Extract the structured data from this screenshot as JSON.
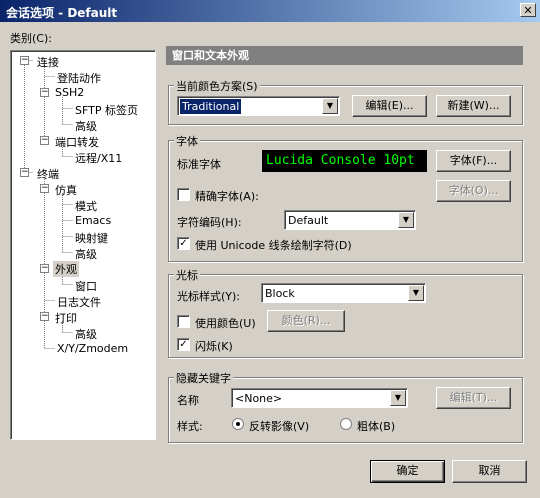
{
  "window": {
    "title": "会话选项 - Default",
    "close_glyph": "✕"
  },
  "tree": {
    "label": "类别(C):",
    "nodes": [
      {
        "label": "连接",
        "expanded": true
      },
      {
        "label": "登陆动作"
      },
      {
        "label": "SSH2",
        "expanded": true
      },
      {
        "label": "SFTP 标签页"
      },
      {
        "label": "高级"
      },
      {
        "label": "端口转发",
        "expanded": true
      },
      {
        "label": "远程/X11"
      },
      {
        "label": "终端",
        "expanded": true
      },
      {
        "label": "仿真",
        "expanded": true
      },
      {
        "label": "模式"
      },
      {
        "label": "Emacs"
      },
      {
        "label": "映射键"
      },
      {
        "label": "高级"
      },
      {
        "label": "外观",
        "expanded": true,
        "selected": true
      },
      {
        "label": "窗口"
      },
      {
        "label": "日志文件"
      },
      {
        "label": "打印",
        "expanded": true
      },
      {
        "label": "高级"
      },
      {
        "label": "X/Y/Zmodem"
      }
    ],
    "expander_glyph": "−"
  },
  "panel": {
    "header": "窗口和文本外观",
    "scheme": {
      "title": "当前颜色方案(S)",
      "value": "Traditional",
      "edit_button": "编辑(E)...",
      "new_button": "新建(W)..."
    },
    "font": {
      "title": "字体",
      "standard_label": "标准字体",
      "preview_text": "Lucida Console 10pt",
      "font_button": "字体(F)...",
      "precise_label": "精确字体(A):",
      "precise_checked": false,
      "precise_button": "字体(O)...",
      "encoding_label": "字符编码(H):",
      "encoding_value": "Default",
      "unicode_label": "使用 Unicode 线条绘制字符(D)",
      "unicode_checked": true
    },
    "cursor": {
      "title": "光标",
      "style_label": "光标样式(Y):",
      "style_value": "Block",
      "use_color_label": "使用颜色(U)",
      "use_color_checked": false,
      "color_button": "颜色(R)...",
      "blink_label": "闪烁(K)",
      "blink_checked": true
    },
    "keywords": {
      "title": "隐藏关键字",
      "name_label": "名称",
      "name_value": "<None>",
      "edit_button": "编辑(T)...",
      "style_label": "样式:",
      "reverse_label": "反转影像(V)",
      "reverse_selected": true,
      "bold_label": "粗体(B)",
      "bold_selected": false
    }
  },
  "footer": {
    "ok_button": "确定",
    "cancel_button": "取消"
  },
  "icons": {
    "check_glyph": "✓",
    "dropdown_glyph": "▼"
  },
  "colors": {
    "titlebar_start": "#0a246a",
    "titlebar_end": "#a6caf0",
    "font_preview_fg": "#00ff00",
    "font_preview_bg": "#000000"
  }
}
